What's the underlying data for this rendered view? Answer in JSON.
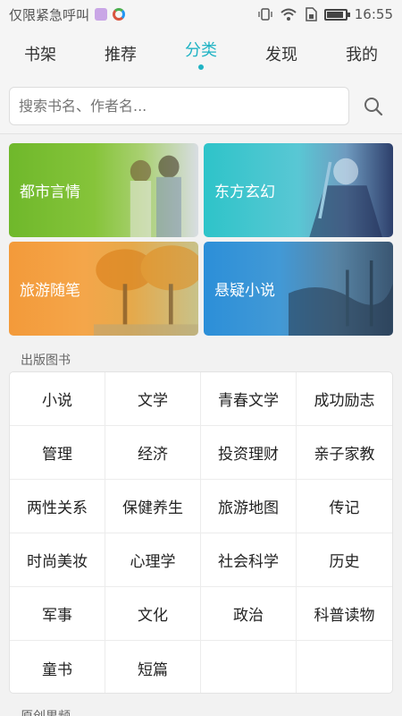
{
  "status_bar": {
    "carrier_text": "仅限紧急呼叫",
    "time": "16:55",
    "icons": [
      "gallery-icon",
      "app-icon",
      "vibrate-icon",
      "wifi-icon",
      "sim-icon",
      "battery-icon"
    ]
  },
  "tabs": [
    {
      "label": "书架",
      "active": false
    },
    {
      "label": "推荐",
      "active": false
    },
    {
      "label": "分类",
      "active": true
    },
    {
      "label": "发现",
      "active": false
    },
    {
      "label": "我的",
      "active": false
    }
  ],
  "search": {
    "placeholder": "搜索书名、作者名..."
  },
  "banners": [
    {
      "label": "都市言情",
      "color": "#6fb82b"
    },
    {
      "label": "东方玄幻",
      "color": "#2ec4c9"
    },
    {
      "label": "旅游随笔",
      "color": "#f39a3a"
    },
    {
      "label": "悬疑小说",
      "color": "#2c8fd8"
    }
  ],
  "published_section": {
    "title": "出版图书",
    "categories": [
      "小说",
      "文学",
      "青春文学",
      "成功励志",
      "管理",
      "经济",
      "投资理财",
      "亲子家教",
      "两性关系",
      "保健养生",
      "旅游地图",
      "传记",
      "时尚美妆",
      "心理学",
      "社会科学",
      "历史",
      "军事",
      "文化",
      "政治",
      "科普读物",
      "童书",
      "短篇",
      "",
      ""
    ]
  },
  "original_section": {
    "title": "原创男频"
  },
  "colors": {
    "accent": "#1fb3c4",
    "background": "#f2f2f2"
  }
}
